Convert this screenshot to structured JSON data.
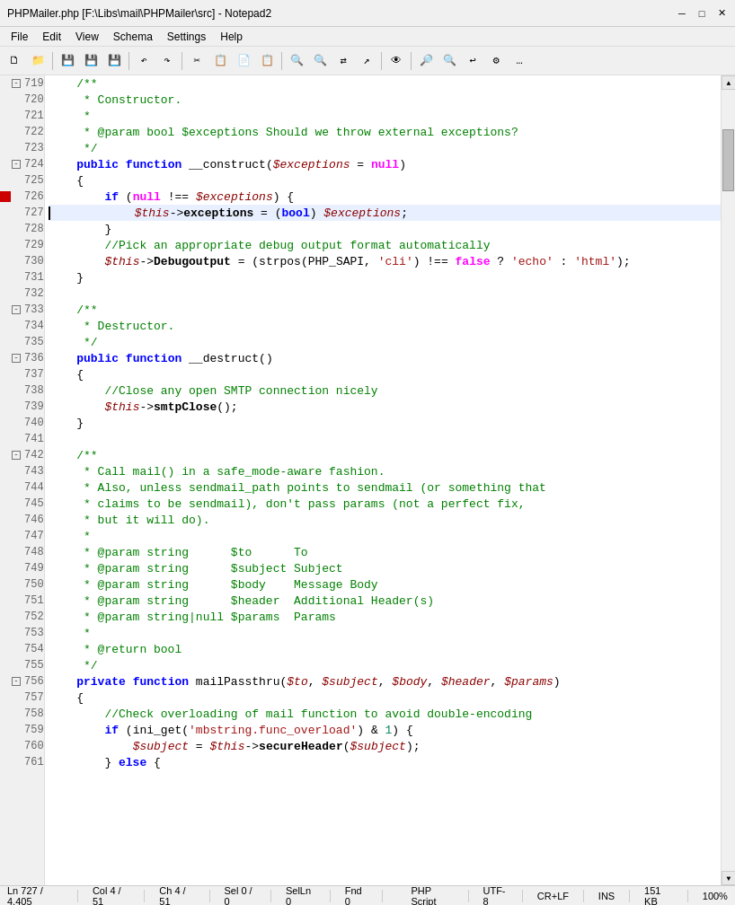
{
  "titleBar": {
    "title": "PHPMailer.php [F:\\Libs\\mail\\PHPMailer\\src] - Notepad2"
  },
  "menuBar": {
    "items": [
      "File",
      "Edit",
      "View",
      "Schema",
      "Settings",
      "Help"
    ]
  },
  "statusBar": {
    "position": "Ln 727 / 4,405",
    "col": "Col 4 / 51",
    "ch": "Ch 4 / 51",
    "sel": "Sel 0 / 0",
    "selLn": "SelLn 0",
    "fnd": "Fnd 0",
    "fileType": "PHP Script",
    "encoding": "UTF-8",
    "lineEnding": "CR+LF",
    "insertMode": "INS",
    "fileSize": "151 KB",
    "zoom": "100%"
  },
  "lines": [
    {
      "num": 719,
      "fold": true,
      "mark": false,
      "content": "    /**",
      "type": "comment"
    },
    {
      "num": 720,
      "fold": false,
      "mark": false,
      "content": "     * Constructor.",
      "type": "comment"
    },
    {
      "num": 721,
      "fold": false,
      "mark": false,
      "content": "     *",
      "type": "comment"
    },
    {
      "num": 722,
      "fold": false,
      "mark": false,
      "content": "     * @param bool $exceptions Should we throw external exceptions?",
      "type": "comment"
    },
    {
      "num": 723,
      "fold": false,
      "mark": false,
      "content": "     */",
      "type": "comment"
    },
    {
      "num": 724,
      "fold": true,
      "mark": false,
      "content": "    public function __construct($exceptions = null)",
      "type": "code"
    },
    {
      "num": 725,
      "fold": false,
      "mark": false,
      "content": "    {",
      "type": "code"
    },
    {
      "num": 726,
      "fold": false,
      "mark": true,
      "content": "        if (null !== $exceptions) {",
      "type": "code"
    },
    {
      "num": 727,
      "fold": false,
      "mark": false,
      "content": "            $this->exceptions = (bool) $exceptions;",
      "type": "code",
      "cursor": true
    },
    {
      "num": 728,
      "fold": false,
      "mark": false,
      "content": "        }",
      "type": "code"
    },
    {
      "num": 729,
      "fold": false,
      "mark": false,
      "content": "        //Pick an appropriate debug output format automatically",
      "type": "comment"
    },
    {
      "num": 730,
      "fold": false,
      "mark": false,
      "content": "        $this->Debugoutput = (strpos(PHP_SAPI, 'cli') !== false ? 'echo' : 'html');",
      "type": "code"
    },
    {
      "num": 731,
      "fold": false,
      "mark": false,
      "content": "    }",
      "type": "code"
    },
    {
      "num": 732,
      "fold": false,
      "mark": false,
      "content": "",
      "type": "empty"
    },
    {
      "num": 733,
      "fold": true,
      "mark": false,
      "content": "    /**",
      "type": "comment"
    },
    {
      "num": 734,
      "fold": false,
      "mark": false,
      "content": "     * Destructor.",
      "type": "comment"
    },
    {
      "num": 735,
      "fold": false,
      "mark": false,
      "content": "     */",
      "type": "comment"
    },
    {
      "num": 736,
      "fold": true,
      "mark": false,
      "content": "    public function __destruct()",
      "type": "code"
    },
    {
      "num": 737,
      "fold": false,
      "mark": false,
      "content": "    {",
      "type": "code"
    },
    {
      "num": 738,
      "fold": false,
      "mark": false,
      "content": "        //Close any open SMTP connection nicely",
      "type": "comment"
    },
    {
      "num": 739,
      "fold": false,
      "mark": false,
      "content": "        $this->smtpClose();",
      "type": "code"
    },
    {
      "num": 740,
      "fold": false,
      "mark": false,
      "content": "    }",
      "type": "code"
    },
    {
      "num": 741,
      "fold": false,
      "mark": false,
      "content": "",
      "type": "empty"
    },
    {
      "num": 742,
      "fold": true,
      "mark": false,
      "content": "    /**",
      "type": "comment"
    },
    {
      "num": 743,
      "fold": false,
      "mark": false,
      "content": "     * Call mail() in a safe_mode-aware fashion.",
      "type": "comment"
    },
    {
      "num": 744,
      "fold": false,
      "mark": false,
      "content": "     * Also, unless sendmail_path points to sendmail (or something that",
      "type": "comment"
    },
    {
      "num": 745,
      "fold": false,
      "mark": false,
      "content": "     * claims to be sendmail), don't pass params (not a perfect fix,",
      "type": "comment"
    },
    {
      "num": 746,
      "fold": false,
      "mark": false,
      "content": "     * but it will do).",
      "type": "comment"
    },
    {
      "num": 747,
      "fold": false,
      "mark": false,
      "content": "     *",
      "type": "comment"
    },
    {
      "num": 748,
      "fold": false,
      "mark": false,
      "content": "     * @param string      $to      To",
      "type": "comment"
    },
    {
      "num": 749,
      "fold": false,
      "mark": false,
      "content": "     * @param string      $subject Subject",
      "type": "comment"
    },
    {
      "num": 750,
      "fold": false,
      "mark": false,
      "content": "     * @param string      $body    Message Body",
      "type": "comment"
    },
    {
      "num": 751,
      "fold": false,
      "mark": false,
      "content": "     * @param string      $header  Additional Header(s)",
      "type": "comment"
    },
    {
      "num": 752,
      "fold": false,
      "mark": false,
      "content": "     * @param string|null $params  Params",
      "type": "comment"
    },
    {
      "num": 753,
      "fold": false,
      "mark": false,
      "content": "     *",
      "type": "comment"
    },
    {
      "num": 754,
      "fold": false,
      "mark": false,
      "content": "     * @return bool",
      "type": "comment"
    },
    {
      "num": 755,
      "fold": false,
      "mark": false,
      "content": "     */",
      "type": "comment"
    },
    {
      "num": 756,
      "fold": true,
      "mark": false,
      "content": "    private function mailPassthru($to, $subject, $body, $header, $params)",
      "type": "code"
    },
    {
      "num": 757,
      "fold": false,
      "mark": false,
      "content": "    {",
      "type": "code"
    },
    {
      "num": 758,
      "fold": false,
      "mark": false,
      "content": "        //Check overloading of mail function to avoid double-encoding",
      "type": "comment"
    },
    {
      "num": 759,
      "fold": false,
      "mark": false,
      "content": "        if (ini_get('mbstring.func_overload') & 1) {",
      "type": "code"
    },
    {
      "num": 760,
      "fold": false,
      "mark": false,
      "content": "            $subject = $this->secureHeader($subject);",
      "type": "code"
    },
    {
      "num": 761,
      "fold": false,
      "mark": false,
      "content": "        } else {",
      "type": "code"
    }
  ]
}
